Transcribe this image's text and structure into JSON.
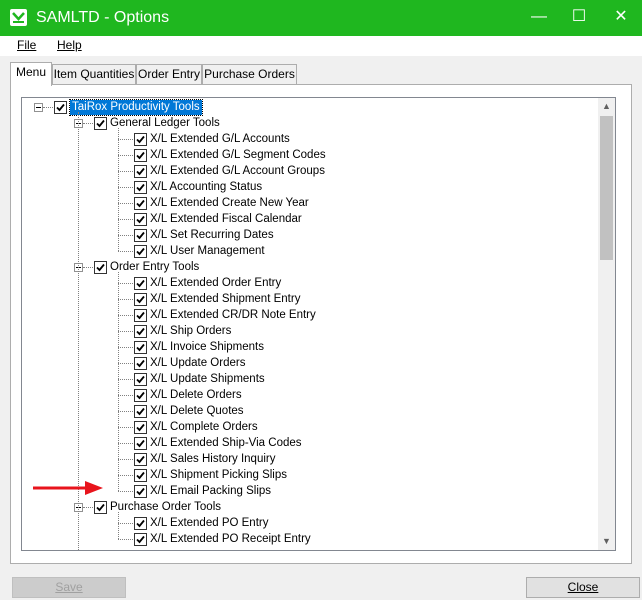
{
  "window": {
    "title": "SAMLTD - Options"
  },
  "menu": {
    "file": "File",
    "help": "Help"
  },
  "tabs": [
    "Menu",
    "Item Quantities",
    "Order Entry",
    "Purchase Orders"
  ],
  "tree": {
    "root": "TaiRox Productivity Tools",
    "groups": [
      {
        "label": "General Ledger Tools",
        "items": [
          "X/L Extended G/L Accounts",
          "X/L Extended G/L Segment Codes",
          "X/L Extended G/L Account Groups",
          "X/L Accounting Status",
          "X/L Extended Create New Year",
          "X/L Extended Fiscal Calendar",
          "X/L Set Recurring Dates",
          "X/L User Management"
        ]
      },
      {
        "label": "Order Entry Tools",
        "items": [
          "X/L Extended Order Entry",
          "X/L Extended Shipment Entry",
          "X/L Extended CR/DR Note Entry",
          "X/L Ship Orders",
          "X/L Invoice Shipments",
          "X/L Update Orders",
          "X/L Update Shipments",
          "X/L Delete Orders",
          "X/L Delete Quotes",
          "X/L Complete Orders",
          "X/L Extended Ship-Via Codes",
          "X/L Sales History Inquiry",
          "X/L Shipment Picking Slips",
          "X/L Email Packing Slips"
        ]
      },
      {
        "label": "Purchase Order Tools",
        "items": [
          "X/L Extended PO Entry",
          "X/L Extended PO Receipt Entry"
        ]
      }
    ]
  },
  "buttons": {
    "save": "Save",
    "close": "Close"
  },
  "colors": {
    "titlebar": "#1fb71f",
    "selection": "#0078d7",
    "arrow": "#e8141c"
  }
}
